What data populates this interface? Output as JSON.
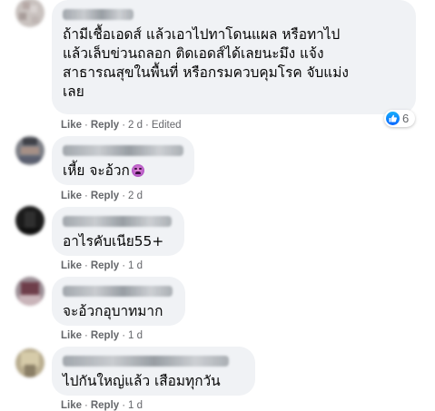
{
  "comments": [
    {
      "text": "ถ้ามีเชื้อเอดส์ แล้วเอาไปทาโดนแผล หรือทาไป\nแล้วเล็บข่วนถลอก ติดเอดส์ได้เลยนะมึง แจ้ง\nสาธารณสุขในพื้นที่ หรือกรมควบคุมโรค จับแม่ง\nเลย",
      "like": "Like",
      "reply": "Reply",
      "time": "2 d",
      "edited": "Edited",
      "reactions": {
        "icon": "like-icon",
        "count": "6"
      }
    },
    {
      "text": "เหี้ย จะอ้วก",
      "emoji": "nauseated-face-icon",
      "like": "Like",
      "reply": "Reply",
      "time": "2 d"
    },
    {
      "text": "อาไรคับเนีย55+",
      "like": "Like",
      "reply": "Reply",
      "time": "1 d"
    },
    {
      "text": "จะอ้วกอุบาทมาก",
      "like": "Like",
      "reply": "Reply",
      "time": "1 d"
    },
    {
      "text": "ไปกันใหญ่แล้ว เสือมทุกวัน",
      "like": "Like",
      "reply": "Reply",
      "time": "1 d"
    }
  ],
  "colors": {
    "bubble": "#f0f2f5",
    "meta_text": "#65676b",
    "like_blue": "#0866ff"
  }
}
